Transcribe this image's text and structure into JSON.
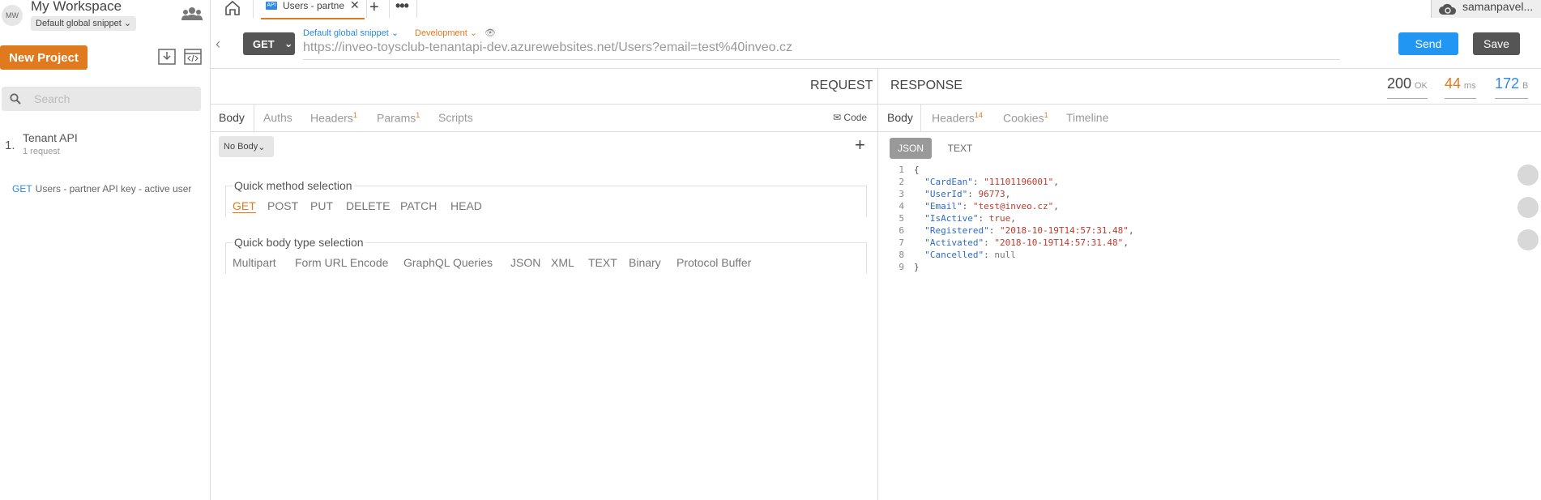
{
  "workspace": {
    "avatar": "MW",
    "name": "My Workspace",
    "snippet": "Default global snippet"
  },
  "sidebar": {
    "new_project": "New Project",
    "search_placeholder": "Search",
    "collection": {
      "index": "1.",
      "name": "Tenant API",
      "count": "1 request"
    },
    "request": {
      "method": "GET",
      "name": "Users - partner API key - active user"
    }
  },
  "tabs": [
    {
      "badge": "API",
      "label": "Users - partner API key - active user"
    }
  ],
  "user": {
    "name": "samanpavel..."
  },
  "request": {
    "method": "GET",
    "snippet": "Default global snippet",
    "environment": "Development",
    "url": "https://inveo-toysclub-tenantapi-dev.azurewebsites.net/Users?email=test%40inveo.cz",
    "send": "Send",
    "save": "Save",
    "title": "REQUEST",
    "tabs": [
      {
        "label": "Body",
        "sup": ""
      },
      {
        "label": "Auths",
        "sup": ""
      },
      {
        "label": "Headers",
        "sup": "1"
      },
      {
        "label": "Params",
        "sup": "1"
      },
      {
        "label": "Scripts",
        "sup": ""
      }
    ],
    "code_label": "Code",
    "body_type": "No Body",
    "quick_method": {
      "legend": "Quick method selection",
      "options": [
        "GET",
        "POST",
        "PUT",
        "DELETE",
        "PATCH",
        "HEAD"
      ],
      "selected": "GET"
    },
    "quick_body": {
      "legend": "Quick body type selection",
      "options": [
        "Multipart",
        "Form URL Encode",
        "GraphQL Queries",
        "JSON",
        "XML",
        "TEXT",
        "Binary",
        "Protocol Buffer"
      ]
    }
  },
  "response": {
    "title": "RESPONSE",
    "status_code": "200",
    "status_text": "OK",
    "time_value": "44",
    "time_unit": "ms",
    "size_value": "172",
    "size_unit": "B",
    "tabs": [
      {
        "label": "Body",
        "sup": ""
      },
      {
        "label": "Headers",
        "sup": "14"
      },
      {
        "label": "Cookies",
        "sup": "1"
      },
      {
        "label": "Timeline",
        "sup": ""
      }
    ],
    "formats": [
      "JSON",
      "TEXT"
    ],
    "body_lines": [
      {
        "no": "1",
        "text": "{"
      },
      {
        "no": "2",
        "key": "\"CardEan\"",
        "val": "\"11101196001\"",
        "type": "s",
        "comma": ","
      },
      {
        "no": "3",
        "key": "\"UserId\"",
        "val": "96773",
        "type": "n",
        "comma": ","
      },
      {
        "no": "4",
        "key": "\"Email\"",
        "val": "\"test@inveo.cz\"",
        "type": "s",
        "comma": ","
      },
      {
        "no": "5",
        "key": "\"IsActive\"",
        "val": "true",
        "type": "b",
        "comma": ","
      },
      {
        "no": "6",
        "key": "\"Registered\"",
        "val": "\"2018-10-19T14:57:31.48\"",
        "type": "s",
        "comma": ","
      },
      {
        "no": "7",
        "key": "\"Activated\"",
        "val": "\"2018-10-19T14:57:31.48\"",
        "type": "s",
        "comma": ","
      },
      {
        "no": "8",
        "key": "\"Cancelled\"",
        "val": "null",
        "type": "nu",
        "comma": ""
      },
      {
        "no": "9",
        "text": "}"
      }
    ]
  },
  "colors": {
    "accent": "#e07a1f",
    "send": "#2196f3",
    "link": "#2d8ae0"
  }
}
